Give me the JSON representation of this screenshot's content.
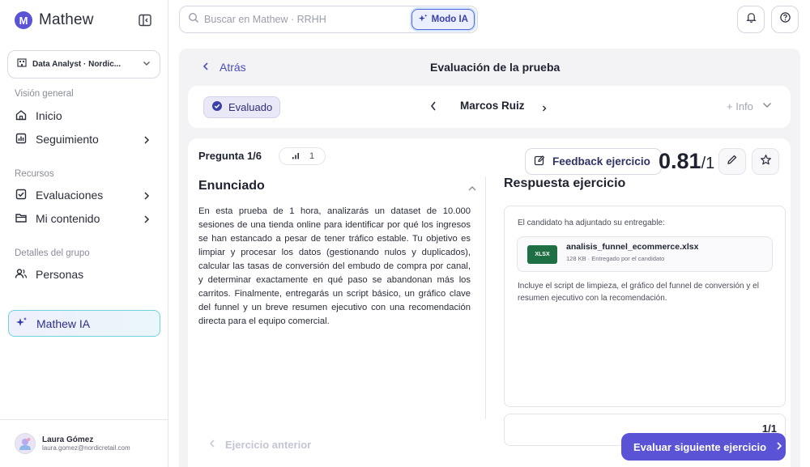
{
  "app": {
    "name": "Mathew",
    "logo_letter": "M"
  },
  "sidebar": {
    "workspace": "Data Analyst · Nordic...",
    "sections": {
      "overview": "Visión general",
      "resources": "Recursos",
      "group": "Detalles del grupo"
    },
    "items": {
      "inicio": "Inicio",
      "seguimiento": "Seguimiento",
      "evaluaciones": "Evaluaciones",
      "contenido": "Mi contenido",
      "personas": "Personas",
      "ia": "Mathew IA"
    },
    "user": {
      "name": "Laura Gómez",
      "email": "laura.gomez@nordicretail.com"
    }
  },
  "topbar": {
    "search_placeholder": "Buscar en Mathew · RRHH",
    "ai_mode": "Modo IA"
  },
  "page": {
    "back": "Atrás",
    "title": "Evaluación de la prueba",
    "status": "Evaluado",
    "candidate": "Marcos Ruiz",
    "info": "+ Info"
  },
  "question": {
    "label": "Pregunta 1/6",
    "difficulty": "1",
    "feedback_button": "Feedback ejercicio",
    "score": "0.81",
    "score_max": "/1",
    "enunciado_title": "Enunciado",
    "enunciado": "En esta prueba de 1 hora, analizarás un dataset de 10.000 sesiones de una tienda online para identificar por qué los ingresos se han estancado a pesar de tener tráfico estable. Tu objetivo es limpiar y procesar los datos (gestionando nulos y duplicados), calcular las tasas de conversión del embudo de compra por canal, y determinar exactamente en qué paso se abandonan más los carritos. Finalmente, entregarás un script básico, un gráfico clave del funnel y un breve resumen ejecutivo con una recomendación directa para el equipo comercial."
  },
  "response": {
    "title": "Respuesta ejercicio",
    "intro": "El candidato ha adjuntado su entregable:",
    "file": {
      "type": "XLSX",
      "name": "analisis_funnel_ecommerce.xlsx",
      "meta": "128 KB · Entregado por el candidato"
    },
    "description": "Incluye el script de limpieza, el gráfico del funnel de conversión y el resumen ejecutivo con la recomendación.",
    "partial_score": "1/1"
  },
  "footer": {
    "prev": "Ejercicio anterior",
    "next": "Evaluar siguiente ejercicio"
  },
  "colors": {
    "accent": "#5a53d6",
    "excel": "#1e6f43",
    "ia_border": "#6fd3df"
  }
}
